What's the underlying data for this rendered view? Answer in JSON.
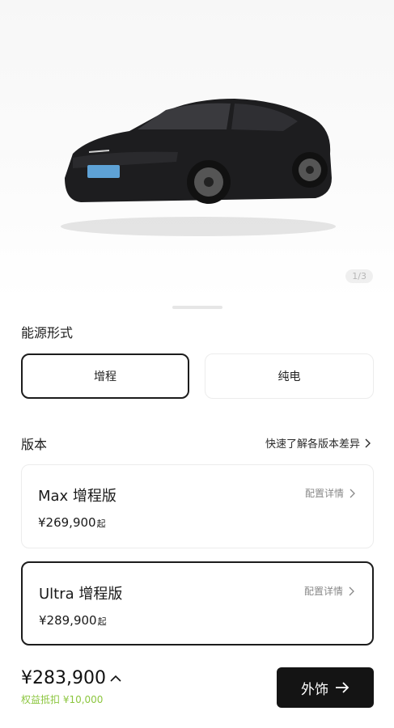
{
  "hero": {
    "pager": "1/3"
  },
  "energy": {
    "title": "能源形式",
    "options": [
      {
        "label": "增程",
        "selected": true
      },
      {
        "label": "纯电",
        "selected": false
      }
    ]
  },
  "version": {
    "title": "版本",
    "compare_link": "快速了解各版本差异",
    "items": [
      {
        "name": "Max 增程版",
        "price": "¥269,900",
        "price_suffix": "起",
        "detail": "配置详情",
        "selected": false
      },
      {
        "name": "Ultra 增程版",
        "price": "¥289,900",
        "price_suffix": "起",
        "detail": "配置详情",
        "selected": true
      }
    ]
  },
  "bottom": {
    "total": "¥283,900",
    "discount": "权益抵扣 ¥10,000",
    "next_label": "外饰"
  },
  "colors": {
    "accent": "#141414",
    "discount": "#8cc63f",
    "border": "#ececec"
  }
}
